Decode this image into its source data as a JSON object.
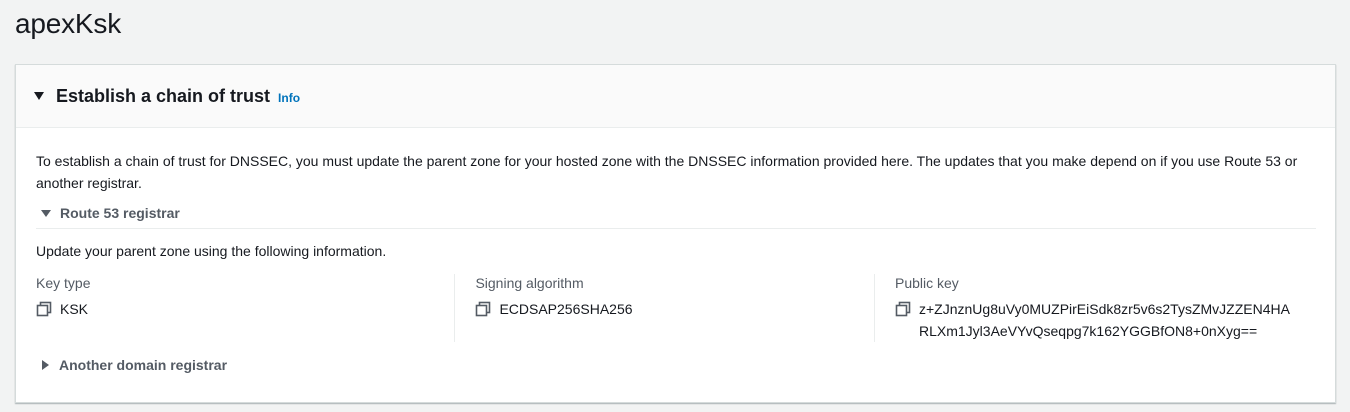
{
  "page": {
    "title": "apexKsk"
  },
  "panel": {
    "title": "Establish a chain of trust",
    "info_label": "Info",
    "description": "To establish a chain of trust for DNSSEC, you must update the parent zone for your hosted zone with the DNSSEC information provided here. The updates that you make depend on if you use Route 53 or another registrar.",
    "route53": {
      "label": "Route 53 registrar",
      "expanded": true,
      "instruction": "Update your parent zone using the following information.",
      "fields": [
        {
          "label": "Key type",
          "value": "KSK"
        },
        {
          "label": "Signing algorithm",
          "value": "ECDSAP256SHA256"
        },
        {
          "label": "Public key",
          "value": "z+ZJnznUg8uVy0MUZPirEiSdk8zr5v6s2TysZMvJZZEN4HARLXm1Jyl3AeVYvQseqpg7k162YGGBfON8+0nXyg=="
        }
      ]
    },
    "another": {
      "label": "Another domain registrar",
      "expanded": false
    }
  },
  "icons": {
    "expand": "caret-down-icon",
    "collapse": "caret-right-icon",
    "copy": "copy-icon"
  },
  "colors": {
    "link": "#0073bb",
    "text": "#16191f",
    "secondary": "#545b64",
    "background": "#f2f3f3"
  }
}
